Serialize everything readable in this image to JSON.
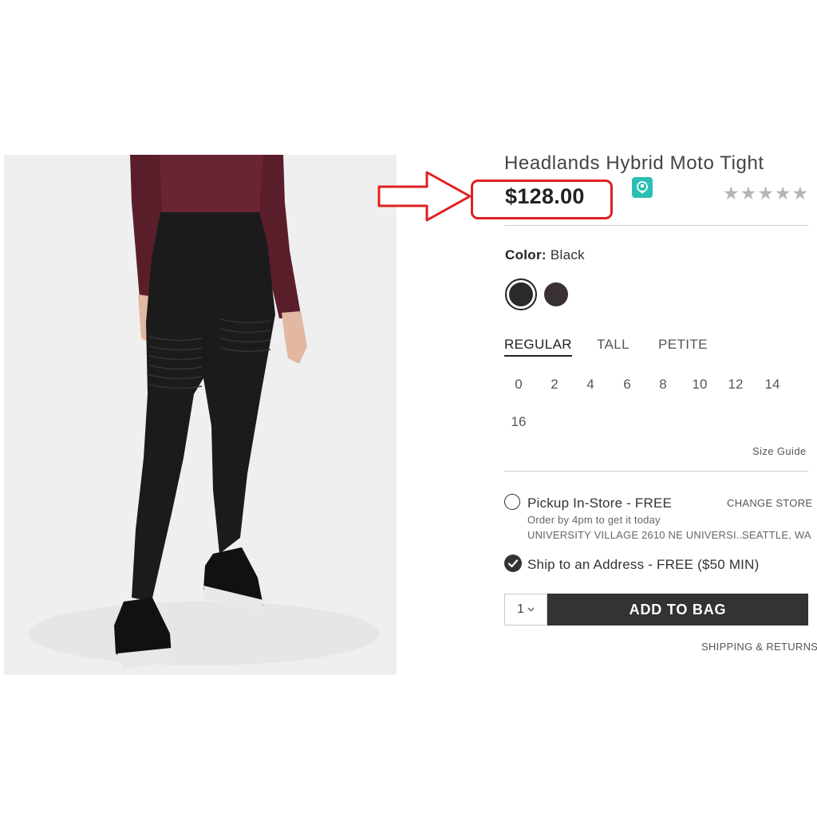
{
  "product": {
    "title": "Headlands Hybrid Moto Tight",
    "price": "$128.00",
    "stars": "★★★★★"
  },
  "color": {
    "label": "Color:",
    "selected": "Black",
    "swatches": [
      "#2a2a2a",
      "#3a3232"
    ]
  },
  "fit_tabs": [
    "REGULAR",
    "TALL",
    "PETITE"
  ],
  "sizes": [
    "0",
    "2",
    "4",
    "6",
    "8",
    "10",
    "12",
    "14",
    "16"
  ],
  "size_guide": "Size Guide",
  "pickup": {
    "label": "Pickup In-Store - FREE",
    "note": "Order by 4pm to get it today",
    "store_address": "UNIVERSITY VILLAGE 2610 NE UNIVERSI...",
    "store_city": "SEATTLE, WA",
    "change_store": "CHANGE STORE"
  },
  "ship": {
    "label": "Ship to an Address - FREE ($50 MIN)"
  },
  "quantity": "1",
  "add_to_bag": "ADD TO BAG",
  "shipping_returns": "SHIPPING & RETURNS",
  "icons": [
    "chevron-down-icon",
    "checkmark-icon",
    "extension-icon",
    "red-arrow-annotation"
  ],
  "colors": {
    "accent": "#333333",
    "annotation": "#e02020",
    "extension": "#2bbfb3"
  }
}
